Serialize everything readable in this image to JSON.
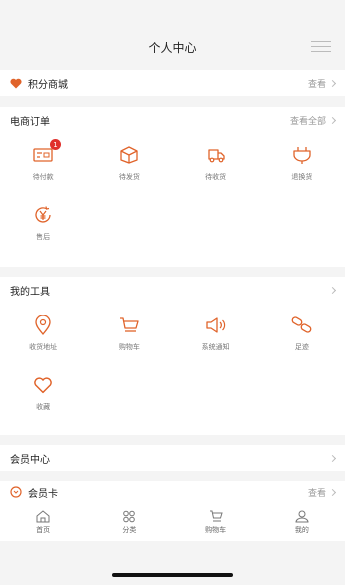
{
  "header": {
    "title": "个人中心"
  },
  "points_mall": {
    "label": "积分商城",
    "more": "查看"
  },
  "ecommerce": {
    "title": "电商订单",
    "more": "查看全部",
    "items": [
      {
        "label": "待付款",
        "badge": "1",
        "icon": "wallet-icon"
      },
      {
        "label": "待发货",
        "icon": "box-icon"
      },
      {
        "label": "待收货",
        "icon": "truck-icon"
      },
      {
        "label": "退换货",
        "icon": "return-icon"
      },
      {
        "label": "售后",
        "icon": "yen-service-icon"
      }
    ]
  },
  "tools": {
    "title": "我的工具",
    "items": [
      {
        "label": "收货地址",
        "icon": "location-icon"
      },
      {
        "label": "购物车",
        "icon": "cart-icon"
      },
      {
        "label": "系统通知",
        "icon": "speaker-icon"
      },
      {
        "label": "足迹",
        "icon": "footprint-icon"
      },
      {
        "label": "收藏",
        "icon": "heart-icon"
      }
    ]
  },
  "member_center": {
    "label": "会员中心"
  },
  "member_card": {
    "label": "会员卡",
    "more": "查看"
  },
  "tabbar": {
    "items": [
      {
        "label": "首页",
        "icon": "home-icon"
      },
      {
        "label": "分类",
        "icon": "category-icon"
      },
      {
        "label": "购物车",
        "icon": "cart-icon"
      },
      {
        "label": "我的",
        "icon": "user-icon"
      }
    ]
  },
  "colors": {
    "accent": "#e0632a",
    "badge": "#e0302c",
    "background": "#f4f4f4"
  }
}
